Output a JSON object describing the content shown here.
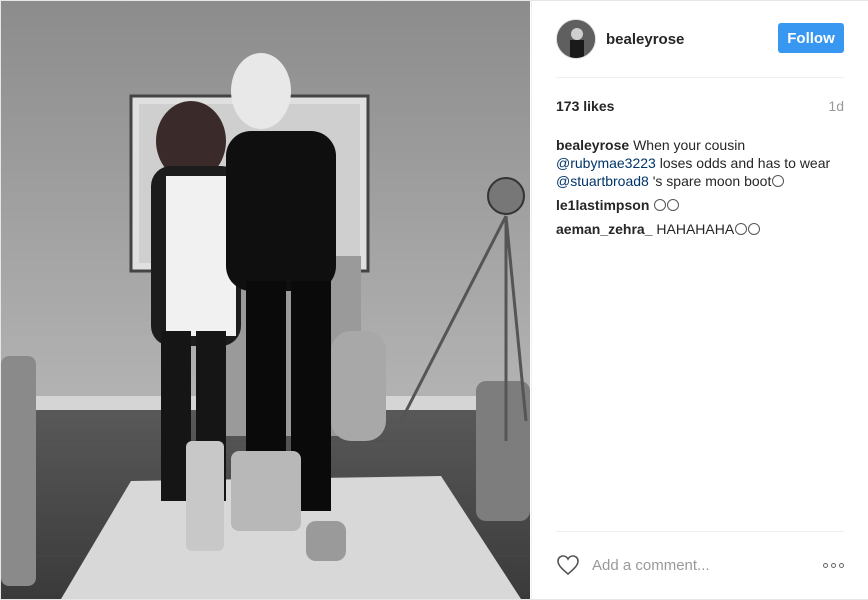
{
  "post": {
    "username": "bealeyrose",
    "follow_label": "Follow",
    "likes": "173 likes",
    "time": "1d"
  },
  "comments": [
    {
      "user": "bealeyrose",
      "parts": [
        {
          "text": "When your cousin ",
          "mention": false
        },
        {
          "text": "@rubymae3223",
          "mention": true
        },
        {
          "text": " loses odds and has to wear ",
          "mention": false
        },
        {
          "text": "@stuartbroad8",
          "mention": true
        },
        {
          "text": " 's spare moon boot",
          "mention": false
        }
      ],
      "emoji_count": 1
    },
    {
      "user": "le1lastimpson",
      "parts": [
        {
          "text": "",
          "mention": false
        }
      ],
      "emoji_count": 2
    },
    {
      "user": "aeman_zehra_",
      "parts": [
        {
          "text": "HAHAHAHA",
          "mention": false
        }
      ],
      "emoji_count": 2
    }
  ],
  "footer": {
    "add_comment_placeholder": "Add a comment...",
    "like_icon": "heart-icon",
    "more_icon": "more-options-icon"
  },
  "colors": {
    "follow_button": "#3897f0",
    "mention": "#003569",
    "muted": "#999999"
  }
}
